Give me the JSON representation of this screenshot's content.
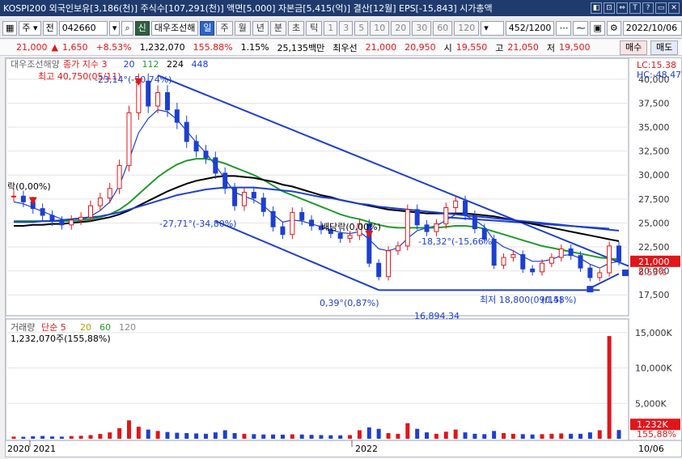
{
  "window": {
    "title": "KOSPI200 외국인보유[3,186(천)] 주식수[107,291(천)] 액면[5,000] 자본금[5,415(억)] 결산[12월] EPS[-15,843] 시가총액",
    "buttons": [
      "◧",
      "⊡",
      "⇔",
      "T",
      "?",
      "▭",
      "✕"
    ]
  },
  "toolbar": {
    "type_select": "주",
    "prev_label": "전",
    "code_value": "042660",
    "search_icon": "magnifier-icon",
    "credit_badge": "신",
    "stock_name": "대우조선해",
    "periods": [
      "일",
      "주",
      "월",
      "년",
      "분",
      "초",
      "틱"
    ],
    "active_period": "일",
    "intervals": [
      "1",
      "3",
      "5",
      "10",
      "20",
      "30",
      "60",
      "120"
    ],
    "count_value": "452",
    "count_max": "/1200",
    "date_value": "2022/10/06"
  },
  "quote": {
    "price": "21,000",
    "change_arrow": "▲",
    "change": "1,650",
    "change_pct": "+8.53%",
    "volume": "1,232,070",
    "volume_ratio": "155.88%",
    "turnover": "1.15%",
    "amount": "25,135백만",
    "best_ask_label": "최우선",
    "best_ask": "21,000",
    "best_bid": "20,950",
    "open_label": "시",
    "open": "19,550",
    "high_label": "고",
    "high": "21,050",
    "low_label": "저",
    "low": "19,500",
    "buy_label": "매수",
    "sell_label": "매도"
  },
  "chart_data": [
    {
      "type": "candlestick",
      "title": "",
      "legend": [
        "대우조선해양",
        "종가 지수 3",
        "20",
        "112",
        "224",
        "448"
      ],
      "legend_colors": [
        "#666666",
        "#e0161a",
        "#1d3fd0",
        "#1f9a2c",
        "#000000",
        "#1d3fd0"
      ],
      "info_right": [
        "LC:15.38",
        "HC:-48.47"
      ],
      "ylim": [
        16000,
        41000
      ],
      "y_ticks": [
        "40,000",
        "37,500",
        "35,000",
        "32,500",
        "30,000",
        "27,500",
        "25,000",
        "22,500",
        "20,000",
        "17,500"
      ],
      "y_values": [
        40000,
        37500,
        35000,
        32500,
        30000,
        27500,
        25000,
        22500,
        20000,
        17500
      ],
      "current_price_label": "21,000",
      "current_change_label": "8.53%",
      "annotations": [
        "최고 40,750(05/11)",
        "-23,14°(-50,74%)",
        "락(0,00%)",
        "-27,71°(-34,80%)",
        "배당락(0,00%)",
        "-18,32°(-15,66%)",
        "0,39°(0,87%)",
        "최저 18,800(09/15)",
        "(0,48%)",
        "16,894.34"
      ],
      "series": [
        {
          "name": "종가",
          "color": "#e0161a",
          "values": [
            27800,
            27200,
            26500,
            25800,
            25200,
            24800,
            25300,
            25600,
            26800,
            27600,
            28600,
            31000,
            36500,
            39800,
            37200,
            38600,
            36800,
            35500,
            33500,
            32500,
            31800,
            30200,
            28600,
            26800,
            28200,
            27600,
            26200,
            24600,
            23800,
            26100,
            25300,
            24700,
            24300,
            23900,
            23400,
            23700,
            24900,
            20800,
            19400,
            22100,
            22600,
            26400,
            24800,
            24100,
            24900,
            26600,
            27300,
            25800,
            24400,
            23300,
            20600,
            21400,
            21700,
            20200,
            19900,
            20800,
            21400,
            22300,
            21600,
            20300,
            19300,
            19800,
            22600,
            21000
          ]
        },
        {
          "name": "20",
          "color": "#1d3fd0",
          "values": [
            27200,
            27000,
            26600,
            26200,
            25800,
            25400,
            25200,
            25300,
            25700,
            26300,
            27200,
            28900,
            31600,
            34400,
            35900,
            36800,
            36600,
            35800,
            34600,
            33400,
            32300,
            31000,
            29600,
            28200,
            27800,
            27400,
            26800,
            25900,
            25100,
            25300,
            25200,
            24900,
            24600,
            24300,
            24000,
            23900,
            24100,
            23300,
            22300,
            22100,
            22400,
            23400,
            24200,
            24500,
            24700,
            25300,
            25900,
            25800,
            25300,
            24600,
            23200,
            22500,
            22100,
            21500,
            21000,
            21000,
            21200,
            21600,
            21700,
            21300,
            20700,
            20300,
            20800,
            21000
          ]
        },
        {
          "name": "112",
          "color": "#1f9a2c",
          "values": [
            25200,
            25200,
            25200,
            25200,
            25200,
            25200,
            25200,
            25300,
            25400,
            25600,
            25900,
            26400,
            27100,
            28000,
            28900,
            29800,
            30500,
            31100,
            31500,
            31700,
            31700,
            31500,
            31200,
            30800,
            30400,
            30000,
            29500,
            28900,
            28300,
            27900,
            27500,
            27100,
            26700,
            26300,
            25900,
            25600,
            25400,
            25100,
            24800,
            24600,
            24500,
            24500,
            24500,
            24500,
            24500,
            24600,
            24700,
            24700,
            24600,
            24400,
            24100,
            23800,
            23500,
            23200,
            22900,
            22600,
            22400,
            22200,
            22000,
            21800,
            21600,
            21400,
            21300,
            21200
          ]
        },
        {
          "name": "224",
          "color": "#000000",
          "values": [
            24700,
            24700,
            24800,
            24800,
            24900,
            24900,
            25000,
            25100,
            25200,
            25400,
            25600,
            25900,
            26300,
            26800,
            27300,
            27800,
            28300,
            28700,
            29100,
            29400,
            29600,
            29800,
            29900,
            29900,
            29800,
            29700,
            29500,
            29300,
            29000,
            28800,
            28500,
            28200,
            27900,
            27700,
            27400,
            27200,
            27000,
            26800,
            26600,
            26400,
            26300,
            26200,
            26100,
            26000,
            26000,
            26000,
            26000,
            26000,
            25900,
            25800,
            25700,
            25500,
            25300,
            25100,
            24900,
            24700,
            24500,
            24300,
            24100,
            23900,
            23700,
            23500,
            23300,
            23100
          ]
        },
        {
          "name": "448",
          "color": "#1d3fd0",
          "values": [
            25100,
            25100,
            25100,
            25200,
            25200,
            25300,
            25400,
            25500,
            25600,
            25700,
            25900,
            26100,
            26400,
            26700,
            27000,
            27300,
            27600,
            27900,
            28100,
            28300,
            28500,
            28600,
            28700,
            28700,
            28700,
            28700,
            28600,
            28500,
            28400,
            28300,
            28100,
            27900,
            27700,
            27600,
            27400,
            27200,
            27000,
            26900,
            26700,
            26600,
            26500,
            26400,
            26300,
            26200,
            26100,
            26000,
            25900,
            25800,
            25700,
            25600,
            25500,
            25400,
            25300,
            25200,
            25100,
            25000,
            24900,
            24800,
            24700,
            24600,
            24500,
            24400,
            24300,
            24200
          ]
        }
      ]
    },
    {
      "type": "bar",
      "title": "",
      "legend": [
        "거래량",
        "단순 5",
        "20",
        "60",
        "120"
      ],
      "legend_colors": [
        "#555555",
        "#e0161a",
        "#b8a000",
        "#1f9a2c",
        "#888888"
      ],
      "volume_label": "1,232,070주(155,88%)",
      "ylim": [
        0,
        16000
      ],
      "y_ticks": [
        "15,000K",
        "10,000K",
        "5,000K"
      ],
      "y_values": [
        15000,
        10000,
        5000
      ],
      "current_volume_label": "1,232K",
      "current_ratio_label": "155,88%",
      "values": [
        300,
        280,
        350,
        400,
        320,
        300,
        380,
        420,
        520,
        680,
        900,
        1500,
        2600,
        1700,
        1300,
        1100,
        950,
        850,
        800,
        750,
        700,
        900,
        1200,
        800,
        700,
        650,
        600,
        600,
        580,
        620,
        600,
        550,
        520,
        500,
        480,
        520,
        1200,
        1600,
        1400,
        800,
        700,
        2200,
        1400,
        900,
        700,
        1000,
        1300,
        900,
        700,
        650,
        1100,
        800,
        700,
        650,
        600,
        650,
        700,
        750,
        700,
        700,
        900,
        1200,
        14500,
        1232
      ]
    }
  ],
  "x_axis": {
    "labels": [
      "2020",
      "2021",
      "2022",
      "10/06"
    ]
  }
}
